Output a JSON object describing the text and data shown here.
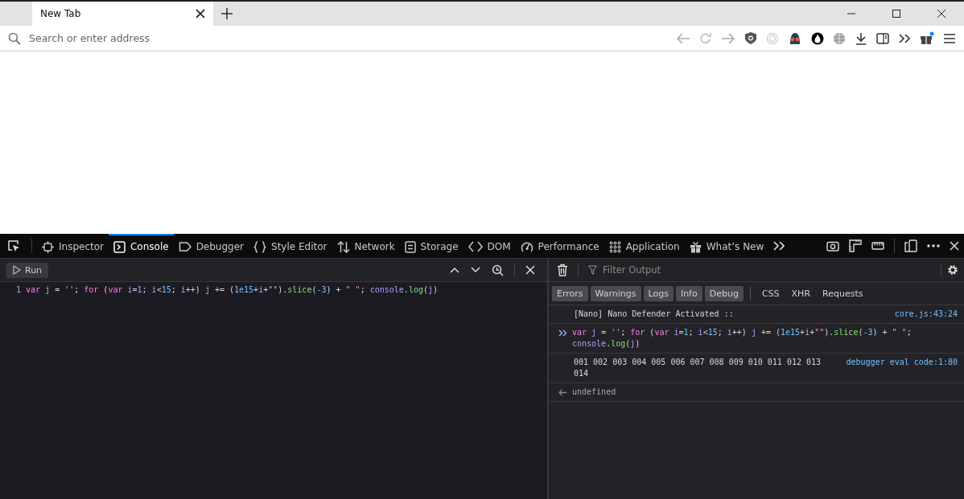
{
  "browser_tabs": [
    {
      "label": "New Tab",
      "selected": true
    }
  ],
  "address_bar": {
    "placeholder": "Search or enter address"
  },
  "devtools": {
    "tabs": [
      {
        "label": "Inspector",
        "kind": "inspector",
        "selected": false
      },
      {
        "label": "Console",
        "kind": "console",
        "selected": true
      },
      {
        "label": "Debugger",
        "kind": "debugger",
        "selected": false
      },
      {
        "label": "Style Editor",
        "kind": "style",
        "selected": false
      },
      {
        "label": "Network",
        "kind": "network",
        "selected": false
      },
      {
        "label": "Storage",
        "kind": "storage",
        "selected": false
      },
      {
        "label": "DOM",
        "kind": "dom",
        "selected": false
      },
      {
        "label": "Performance",
        "kind": "performance",
        "selected": false
      },
      {
        "label": "Application",
        "kind": "application",
        "selected": false
      },
      {
        "label": "What’s New",
        "kind": "whatsnew",
        "selected": false
      }
    ]
  },
  "editor": {
    "run_label": "Run",
    "line_number": "1",
    "tokens": [
      {
        "t": "var",
        "kind": "keyword"
      },
      {
        "t": " j",
        "kind": "name"
      },
      {
        "t": " = ",
        "kind": "plain"
      },
      {
        "t": "''",
        "kind": "string"
      },
      {
        "t": "; ",
        "kind": "plain"
      },
      {
        "t": "for",
        "kind": "keyword"
      },
      {
        "t": " (",
        "kind": "plain"
      },
      {
        "t": "var",
        "kind": "keyword"
      },
      {
        "t": " i",
        "kind": "name"
      },
      {
        "t": "=",
        "kind": "plain"
      },
      {
        "t": "1",
        "kind": "number"
      },
      {
        "t": "; ",
        "kind": "plain"
      },
      {
        "t": "i",
        "kind": "name"
      },
      {
        "t": "<",
        "kind": "plain"
      },
      {
        "t": "15",
        "kind": "number"
      },
      {
        "t": "; ",
        "kind": "plain"
      },
      {
        "t": "i",
        "kind": "name"
      },
      {
        "t": "++) ",
        "kind": "plain"
      },
      {
        "t": "j",
        "kind": "name"
      },
      {
        "t": " += (",
        "kind": "plain"
      },
      {
        "t": "1e15",
        "kind": "number"
      },
      {
        "t": "+",
        "kind": "plain"
      },
      {
        "t": "i",
        "kind": "name"
      },
      {
        "t": "+",
        "kind": "plain"
      },
      {
        "t": "\"\"",
        "kind": "string"
      },
      {
        "t": ").",
        "kind": "plain"
      },
      {
        "t": "slice",
        "kind": "func"
      },
      {
        "t": "(",
        "kind": "plain"
      },
      {
        "t": "-3",
        "kind": "number"
      },
      {
        "t": ") + ",
        "kind": "plain"
      },
      {
        "t": "\" \"",
        "kind": "string"
      },
      {
        "t": "; ",
        "kind": "plain"
      },
      {
        "t": "console",
        "kind": "name"
      },
      {
        "t": ".",
        "kind": "plain"
      },
      {
        "t": "log",
        "kind": "func"
      },
      {
        "t": "(",
        "kind": "plain"
      },
      {
        "t": "j",
        "kind": "name"
      },
      {
        "t": ")",
        "kind": "plain"
      }
    ]
  },
  "console": {
    "filter_placeholder": "Filter Output",
    "level_filters": [
      {
        "label": "Errors",
        "selected": true
      },
      {
        "label": "Warnings",
        "selected": true
      },
      {
        "label": "Logs",
        "selected": true
      },
      {
        "label": "Info",
        "selected": true
      },
      {
        "label": "Debug",
        "selected": true
      }
    ],
    "request_filters": [
      {
        "label": "CSS",
        "selected": false
      },
      {
        "label": "XHR",
        "selected": false
      },
      {
        "label": "Requests",
        "selected": false
      }
    ],
    "messages": [
      {
        "kind": "log",
        "text": "[Nano] Nano Defender Activated ::",
        "source": "core.js:43:24"
      },
      {
        "kind": "input",
        "tokens": [
          {
            "t": "var",
            "kind": "keyword"
          },
          {
            "t": " j",
            "kind": "name"
          },
          {
            "t": " = ",
            "kind": "plain"
          },
          {
            "t": "''",
            "kind": "string"
          },
          {
            "t": "; ",
            "kind": "plain"
          },
          {
            "t": "for",
            "kind": "keyword"
          },
          {
            "t": " (",
            "kind": "plain"
          },
          {
            "t": "var",
            "kind": "keyword"
          },
          {
            "t": " i",
            "kind": "name"
          },
          {
            "t": "=",
            "kind": "plain"
          },
          {
            "t": "1",
            "kind": "number"
          },
          {
            "t": "; ",
            "kind": "plain"
          },
          {
            "t": "i",
            "kind": "name"
          },
          {
            "t": "<",
            "kind": "plain"
          },
          {
            "t": "15",
            "kind": "number"
          },
          {
            "t": "; ",
            "kind": "plain"
          },
          {
            "t": "i",
            "kind": "name"
          },
          {
            "t": "++) ",
            "kind": "plain"
          },
          {
            "t": "j",
            "kind": "name"
          },
          {
            "t": " += (",
            "kind": "plain"
          },
          {
            "t": "1e15",
            "kind": "number"
          },
          {
            "t": "+",
            "kind": "plain"
          },
          {
            "t": "i",
            "kind": "name"
          },
          {
            "t": "+",
            "kind": "plain"
          },
          {
            "t": "\"\"",
            "kind": "string"
          },
          {
            "t": ").",
            "kind": "plain"
          },
          {
            "t": "slice",
            "kind": "func"
          },
          {
            "t": "(",
            "kind": "plain"
          },
          {
            "t": "-3",
            "kind": "number"
          },
          {
            "t": ") + ",
            "kind": "plain"
          },
          {
            "t": "\" \"",
            "kind": "string"
          },
          {
            "t": "; ",
            "kind": "plain"
          },
          {
            "t": "console",
            "kind": "name"
          },
          {
            "t": ".",
            "kind": "plain"
          },
          {
            "t": "log",
            "kind": "func"
          },
          {
            "t": "(",
            "kind": "plain"
          },
          {
            "t": "j",
            "kind": "name"
          },
          {
            "t": ")",
            "kind": "plain"
          }
        ]
      },
      {
        "kind": "log",
        "text": "001 002 003 004 005 006 007 008 009 010 011 012 013 014",
        "source": "debugger eval code:1:80"
      },
      {
        "kind": "result",
        "text": "undefined"
      }
    ]
  }
}
